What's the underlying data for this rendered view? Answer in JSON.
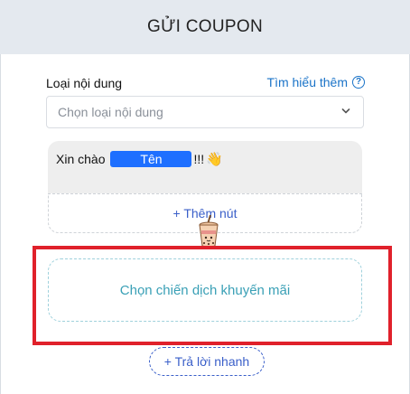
{
  "header": {
    "title": "GỬI COUPON"
  },
  "content_type": {
    "label": "Loại nội dung",
    "learn_more": "Tìm hiểu thêm",
    "help_icon": "question-circle-icon",
    "select_placeholder": "Chọn loại nội dung",
    "select_icon": "chevron-down-icon"
  },
  "message": {
    "greeting_prefix": "Xin chào",
    "name_tag": "Tên",
    "greeting_suffix": "!!!",
    "emoji": "👋",
    "add_button": "+ Thêm nút"
  },
  "campaign": {
    "placeholder": "Chọn chiến dịch khuyến mãi"
  },
  "quick_reply": {
    "label": "+ Trả lời nhanh"
  },
  "colors": {
    "header_bg": "#e4e9ef",
    "link_blue": "#1a73c8",
    "name_tag_blue": "#1e6fff",
    "highlight_red": "#e0212b",
    "campaign_teal": "#3aa0b6"
  }
}
